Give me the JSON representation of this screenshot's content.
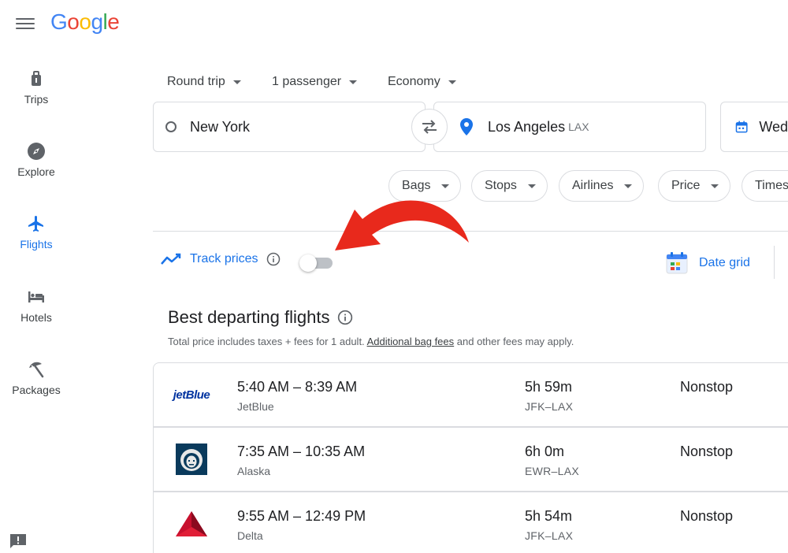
{
  "header": {
    "logo_letters": [
      {
        "char": "G",
        "color": "#4285F4"
      },
      {
        "char": "o",
        "color": "#EA4335"
      },
      {
        "char": "o",
        "color": "#FBBC05"
      },
      {
        "char": "g",
        "color": "#4285F4"
      },
      {
        "char": "l",
        "color": "#34A853"
      },
      {
        "char": "e",
        "color": "#EA4335"
      }
    ]
  },
  "sidebar": {
    "items": [
      {
        "label": "Trips",
        "icon": "luggage-icon"
      },
      {
        "label": "Explore",
        "icon": "compass-icon"
      },
      {
        "label": "Flights",
        "icon": "airplane-icon",
        "active": true
      },
      {
        "label": "Hotels",
        "icon": "bed-icon"
      },
      {
        "label": "Packages",
        "icon": "beach-umbrella-icon"
      }
    ]
  },
  "search": {
    "trip_type": "Round trip",
    "passengers": "1 passenger",
    "cabin": "Economy",
    "origin": "New York",
    "destination": "Los Angeles",
    "destination_code": "LAX",
    "date_partial": "Wed"
  },
  "filters": [
    "Bags",
    "Stops",
    "Airlines",
    "Price",
    "Times"
  ],
  "tracking": {
    "label": "Track prices",
    "enabled": false,
    "date_grid_label": "Date grid"
  },
  "results": {
    "heading": "Best departing flights",
    "note_before": "Total price includes taxes + fees for 1 adult. ",
    "note_link": "Additional bag fees",
    "note_after": " and other fees may apply.",
    "flights": [
      {
        "times": "5:40 AM – 8:39 AM",
        "airline": "JetBlue",
        "logo_text": "jetBlue",
        "duration": "5h 59m",
        "route": "JFK–LAX",
        "stops": "Nonstop"
      },
      {
        "times": "7:35 AM – 10:35 AM",
        "airline": "Alaska",
        "duration": "6h 0m",
        "route": "EWR–LAX",
        "stops": "Nonstop"
      },
      {
        "times": "9:55 AM – 12:49 PM",
        "airline": "Delta",
        "duration": "5h 54m",
        "route": "JFK–LAX",
        "stops": "Nonstop"
      }
    ]
  },
  "colors": {
    "accent": "#1a73e8",
    "annotation_arrow": "#e8291c"
  }
}
